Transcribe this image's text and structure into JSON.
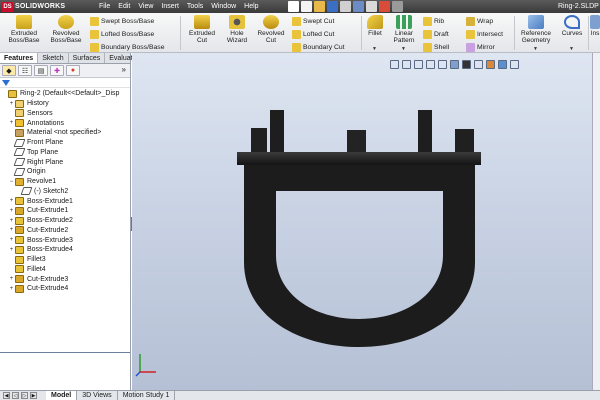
{
  "app": {
    "logo_mark": "DS",
    "logo_text": "SOLIDWORKS",
    "document_title": "Ring-2.SLDP"
  },
  "menu": [
    "File",
    "Edit",
    "View",
    "Insert",
    "Tools",
    "Window",
    "Help"
  ],
  "quick_access": [
    "home-icon",
    "new-file-icon",
    "open-icon",
    "save-icon",
    "print-icon",
    "undo-icon",
    "select-icon",
    "rebuild-icon",
    "options-icon"
  ],
  "ribbon": {
    "extruded_boss": "Extruded\nBoss/Base",
    "revolved_boss": "Revolved\nBoss/Base",
    "swept_boss": "Swept Boss/Base",
    "lofted_boss": "Lofted Boss/Base",
    "boundary_boss": "Boundary Boss/Base",
    "extruded_cut": "Extruded\nCut",
    "hole_wizard": "Hole\nWizard",
    "revolved_cut": "Revolved\nCut",
    "swept_cut": "Swept Cut",
    "lofted_cut": "Lofted Cut",
    "boundary_cut": "Boundary Cut",
    "fillet": "Fillet",
    "linear_pattern": "Linear\nPattern",
    "rib": "Rib",
    "draft": "Draft",
    "shell": "Shell",
    "wrap": "Wrap",
    "intersect": "Intersect",
    "mirror": "Mirror",
    "reference_geometry": "Reference\nGeometry",
    "curves": "Curves",
    "cut_off": "Ins"
  },
  "feature_manager": {
    "tabs": [
      "Features",
      "Sketch",
      "Surfaces",
      "Evaluate"
    ],
    "active_tab": "Features",
    "collapse_glyph": "»",
    "tree": [
      {
        "label": "Ring-2  (Default<<Default>_Disp",
        "icon": "part-icon",
        "indent": 0,
        "expand": ""
      },
      {
        "label": "History",
        "icon": "history-folder-icon",
        "indent": 1,
        "expand": "+"
      },
      {
        "label": "Sensors",
        "icon": "sensors-folder-icon",
        "indent": 1,
        "expand": ""
      },
      {
        "label": "Annotations",
        "icon": "annotations-icon",
        "indent": 1,
        "expand": "+"
      },
      {
        "label": "Material <not specified>",
        "icon": "material-icon",
        "indent": 1,
        "expand": ""
      },
      {
        "label": "Front Plane",
        "icon": "plane-icon",
        "indent": 1,
        "expand": ""
      },
      {
        "label": "Top Plane",
        "icon": "plane-icon",
        "indent": 1,
        "expand": ""
      },
      {
        "label": "Right Plane",
        "icon": "plane-icon",
        "indent": 1,
        "expand": ""
      },
      {
        "label": "Origin",
        "icon": "origin-icon",
        "indent": 1,
        "expand": ""
      },
      {
        "label": "Revolve1",
        "icon": "revolve-feature-icon",
        "indent": 1,
        "expand": "−"
      },
      {
        "label": "(-) Sketch2",
        "icon": "sketch-icon",
        "indent": 2,
        "expand": ""
      },
      {
        "label": "Boss-Extrude1",
        "icon": "boss-extrude-icon",
        "indent": 1,
        "expand": "+"
      },
      {
        "label": "Cut-Extrude1",
        "icon": "cut-extrude-icon",
        "indent": 1,
        "expand": "+"
      },
      {
        "label": "Boss-Extrude2",
        "icon": "boss-extrude-icon",
        "indent": 1,
        "expand": "+"
      },
      {
        "label": "Cut-Extrude2",
        "icon": "cut-extrude-icon",
        "indent": 1,
        "expand": "+"
      },
      {
        "label": "Boss-Extrude3",
        "icon": "boss-extrude-icon",
        "indent": 1,
        "expand": "+"
      },
      {
        "label": "Boss-Extrude4",
        "icon": "boss-extrude-icon",
        "indent": 1,
        "expand": "+"
      },
      {
        "label": "Fillet3",
        "icon": "fillet-icon",
        "indent": 1,
        "expand": ""
      },
      {
        "label": "Fillet4",
        "icon": "fillet-icon",
        "indent": 1,
        "expand": ""
      },
      {
        "label": "Cut-Extrude3",
        "icon": "cut-extrude-icon",
        "indent": 1,
        "expand": "+"
      },
      {
        "label": "Cut-Extrude4",
        "icon": "cut-extrude-icon",
        "indent": 1,
        "expand": "+"
      }
    ]
  },
  "bottom_tabs": [
    "Model",
    "3D Views",
    "Motion Study 1"
  ],
  "active_bottom_tab": "Model",
  "colors": {
    "model": "#1c1c1c",
    "accent": "#c8102e",
    "viewport_top": "#dfe6f2",
    "viewport_bottom": "#b5c0d5"
  }
}
